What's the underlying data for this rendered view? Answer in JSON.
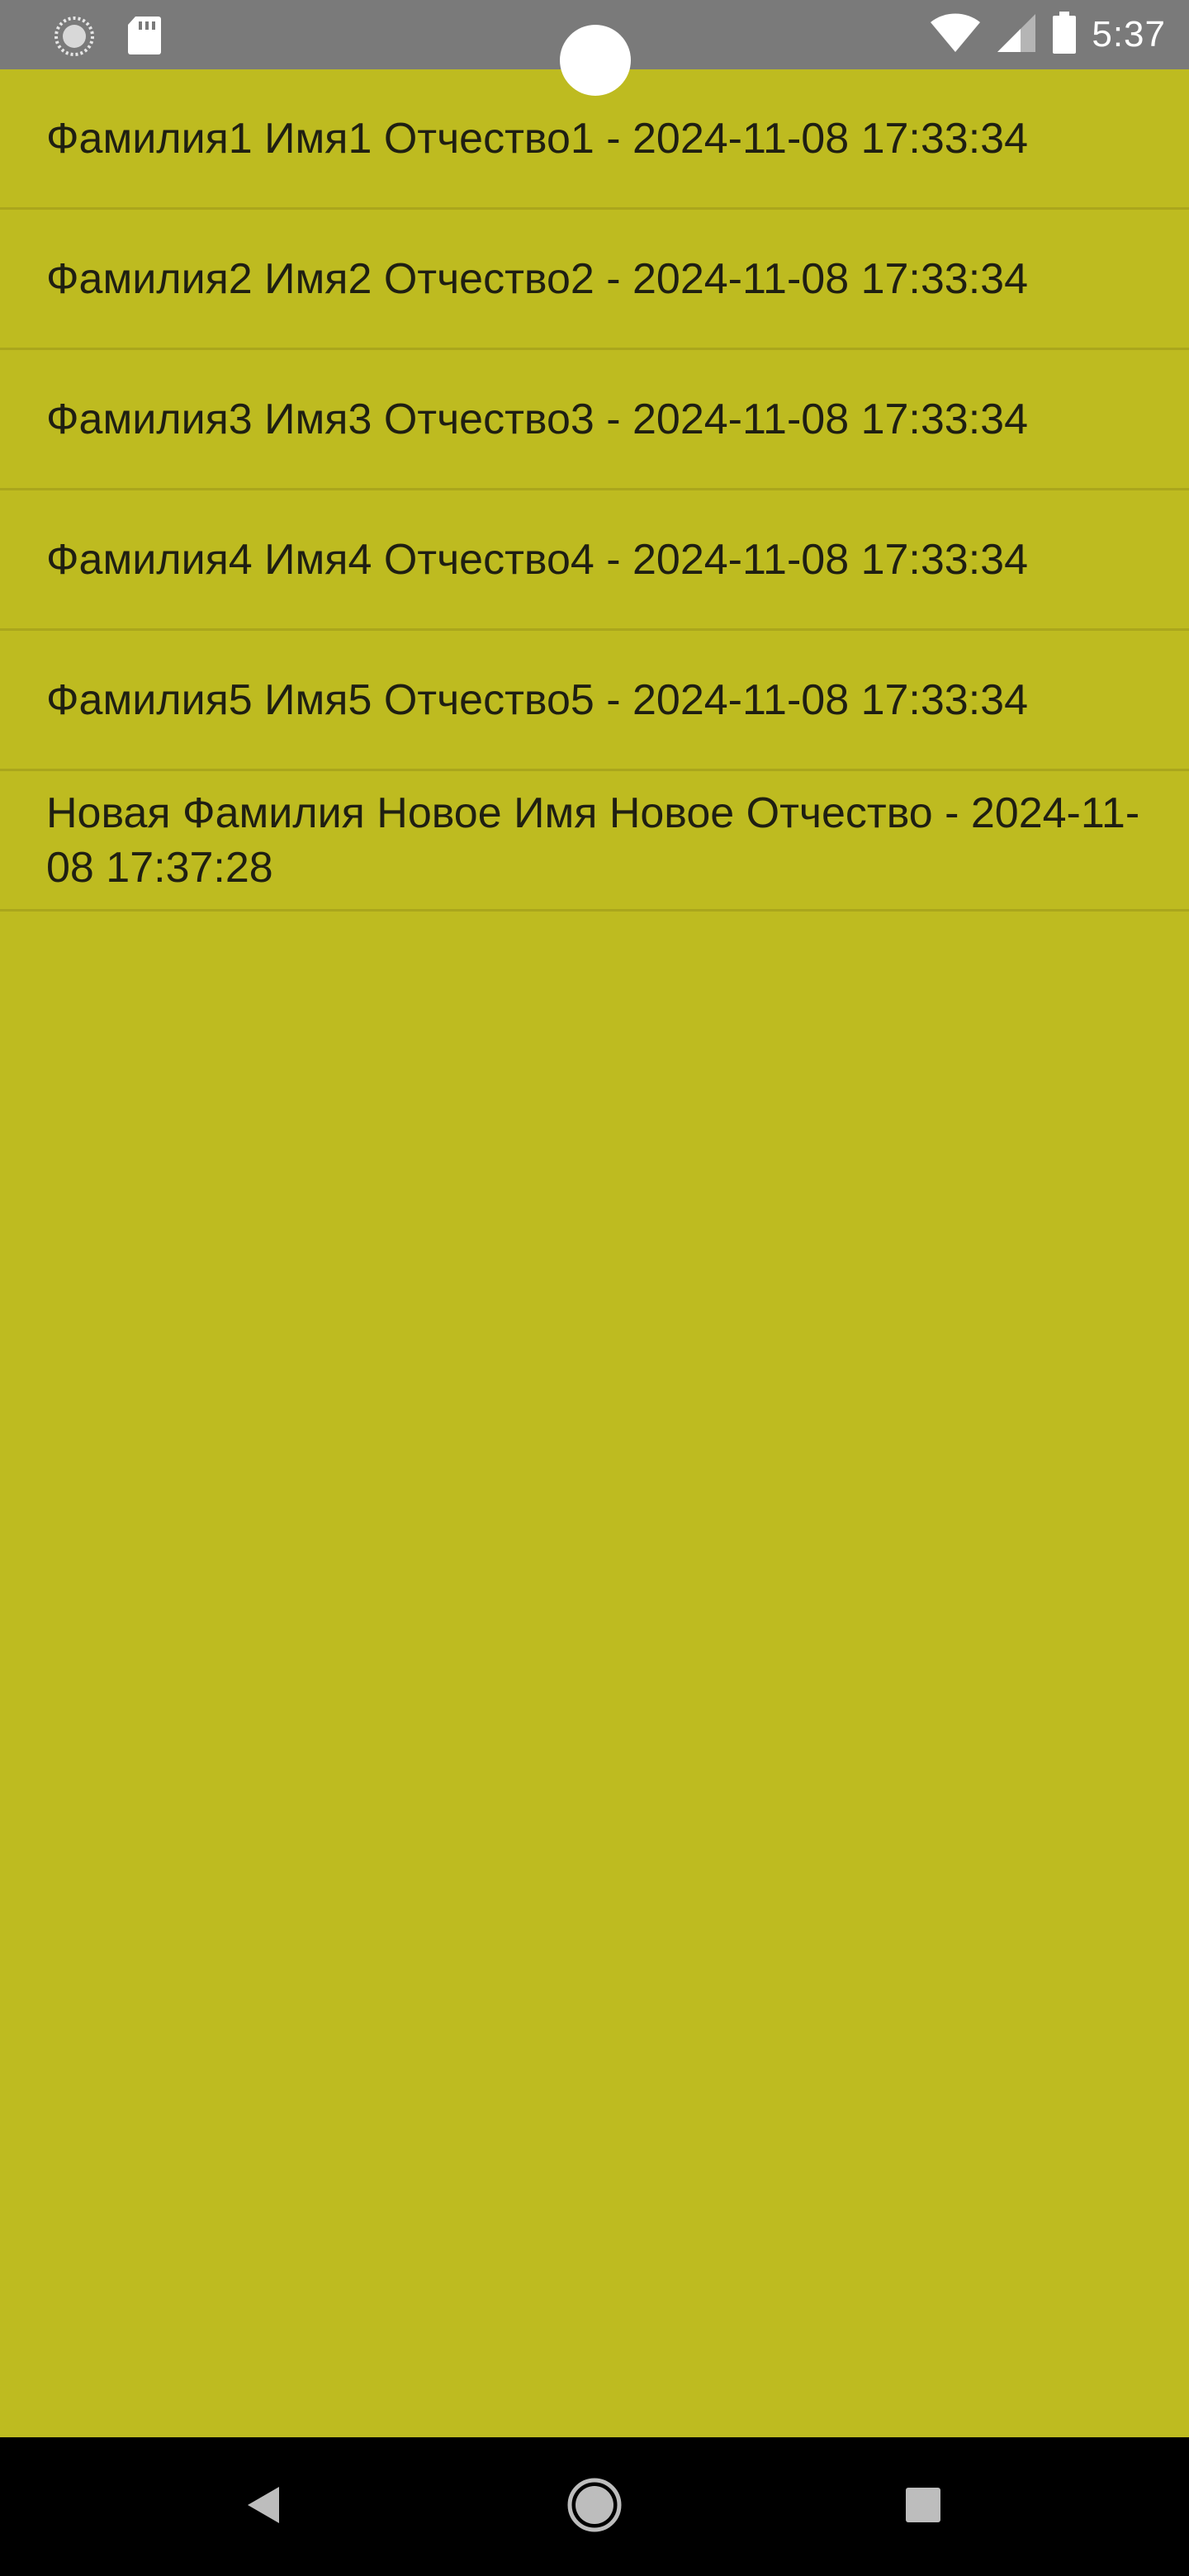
{
  "status_bar": {
    "time": "5:37",
    "left_icons": [
      "loading-circle-icon",
      "sd-card-icon"
    ],
    "right_icons": [
      "wifi-icon",
      "cell-signal-icon",
      "battery-icon"
    ],
    "background": "#7A7A7A"
  },
  "list": {
    "background": "#BEBB20",
    "items": [
      {
        "label": "Фамилия1 Имя1 Отчество1 - 2024-11-08 17:33:34"
      },
      {
        "label": "Фамилия2 Имя2 Отчество2 - 2024-11-08 17:33:34"
      },
      {
        "label": "Фамилия3 Имя3 Отчество3 - 2024-11-08 17:33:34"
      },
      {
        "label": "Фамилия4 Имя4 Отчество4 - 2024-11-08 17:33:34"
      },
      {
        "label": "Фамилия5 Имя5 Отчество5 - 2024-11-08 17:33:34"
      },
      {
        "label": "Новая Фамилия Новое Имя Новое Отчество - 2024-11-08 17:37:28"
      }
    ]
  },
  "nav_bar": {
    "buttons": [
      "back-icon",
      "home-icon",
      "recents-icon"
    ],
    "background": "#000000"
  }
}
